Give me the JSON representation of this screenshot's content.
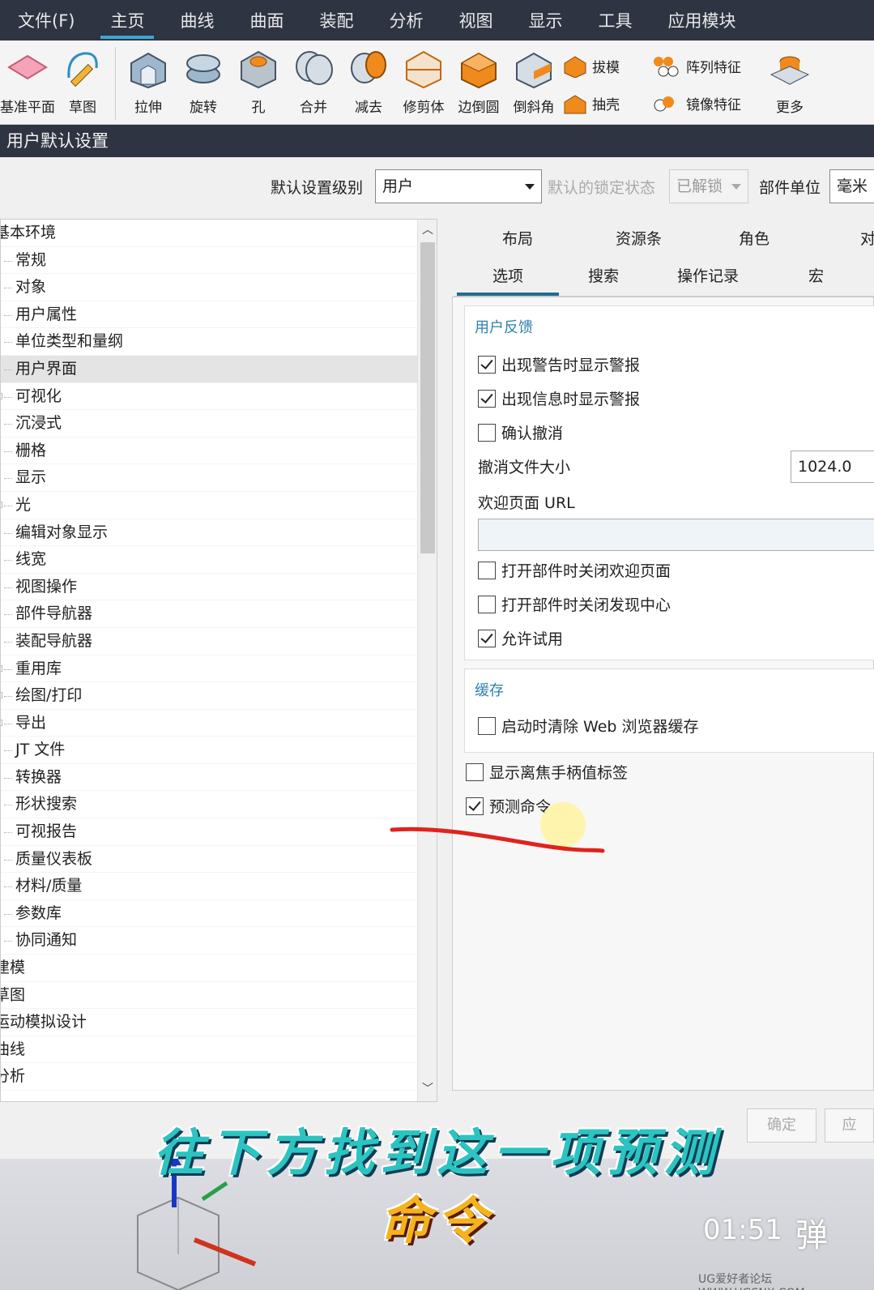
{
  "menubar": {
    "items": [
      "文件(F)",
      "主页",
      "曲线",
      "曲面",
      "装配",
      "分析",
      "视图",
      "显示",
      "工具",
      "应用模块"
    ],
    "active_index": 1
  },
  "ribbon": {
    "buttons": [
      {
        "label": "基准平面",
        "icon": "datum-plane-icon"
      },
      {
        "label": "草图",
        "icon": "sketch-icon"
      },
      {
        "label": "拉伸",
        "icon": "extrude-icon"
      },
      {
        "label": "旋转",
        "icon": "revolve-icon"
      },
      {
        "label": "孔",
        "icon": "hole-icon"
      },
      {
        "label": "合并",
        "icon": "unite-icon"
      },
      {
        "label": "减去",
        "icon": "subtract-icon"
      },
      {
        "label": "修剪体",
        "icon": "trim-body-icon"
      },
      {
        "label": "边倒圆",
        "icon": "edge-blend-icon"
      },
      {
        "label": "倒斜角",
        "icon": "chamfer-icon"
      }
    ],
    "small": [
      "拔模",
      "阵列特征",
      "抽壳",
      "镜像特征"
    ],
    "more": "更多"
  },
  "dialog": {
    "title": "用户默认设置",
    "level_label": "默认设置级别",
    "level_value": "用户",
    "lock_label": "默认的锁定状态",
    "lock_value": "已解锁",
    "unit_label": "部件单位",
    "unit_value": "毫米"
  },
  "tree": {
    "root": "基本环境",
    "children": [
      "常规",
      "对象",
      "用户属性",
      "单位类型和量纲",
      "用户界面",
      "可视化",
      "沉浸式",
      "栅格",
      "显示",
      "光",
      "编辑对象显示",
      "线宽",
      "视图操作",
      "部件导航器",
      "装配导航器",
      "重用库",
      "绘图/打印",
      "导出",
      "JT 文件",
      "转换器",
      "形状搜索",
      "可视报告",
      "质量仪表板",
      "材料/质量",
      "参数库",
      "协同通知"
    ],
    "selected": "用户界面",
    "bottom_roots": [
      "建模",
      "草图",
      "运动模拟设计",
      "曲线",
      "分析"
    ]
  },
  "tabs_row1": [
    "布局",
    "资源条",
    "角色",
    "对"
  ],
  "tabs_row2": [
    "选项",
    "搜索",
    "操作记录",
    "宏"
  ],
  "tabs_row2_active": "选项",
  "feedback": {
    "title": "用户反馈",
    "warn_alert": {
      "label": "出现警告时显示警报",
      "checked": true
    },
    "info_alert": {
      "label": "出现信息时显示警报",
      "checked": true
    },
    "confirm_undo": {
      "label": "确认撤消",
      "checked": false
    },
    "undo_size_label": "撤消文件大小",
    "undo_size_value": "1024.0",
    "welcome_url_label": "欢迎页面 URL",
    "welcome_url_value": "",
    "close_welcome": {
      "label": "打开部件时关闭欢迎页面",
      "checked": false
    },
    "close_discovery": {
      "label": "打开部件时关闭发现中心",
      "checked": false
    },
    "allow_trial": {
      "label": "允许试用",
      "checked": true
    }
  },
  "cache": {
    "title": "缓存",
    "clear_web": {
      "label": "启动时清除 Web 浏览器缓存",
      "checked": false
    }
  },
  "focus_handle": {
    "label": "显示离焦手柄值标签",
    "checked": false
  },
  "predict_cmd": {
    "label": "预测命令",
    "checked": true
  },
  "footer": {
    "ok": "确定",
    "apply": "应"
  },
  "overlay": {
    "caption_line1": "往下方找到这一项预测",
    "caption_line2": "命令",
    "timestamp": "01:51",
    "danmu": "弹",
    "watermark": "UG爱好者论坛 WWW.UGSNX.COM"
  },
  "colors": {
    "titlebar": "#2e3442",
    "accent": "#3ea6d6",
    "group_title": "#2e7fb0",
    "annotation": "#e0231c"
  }
}
